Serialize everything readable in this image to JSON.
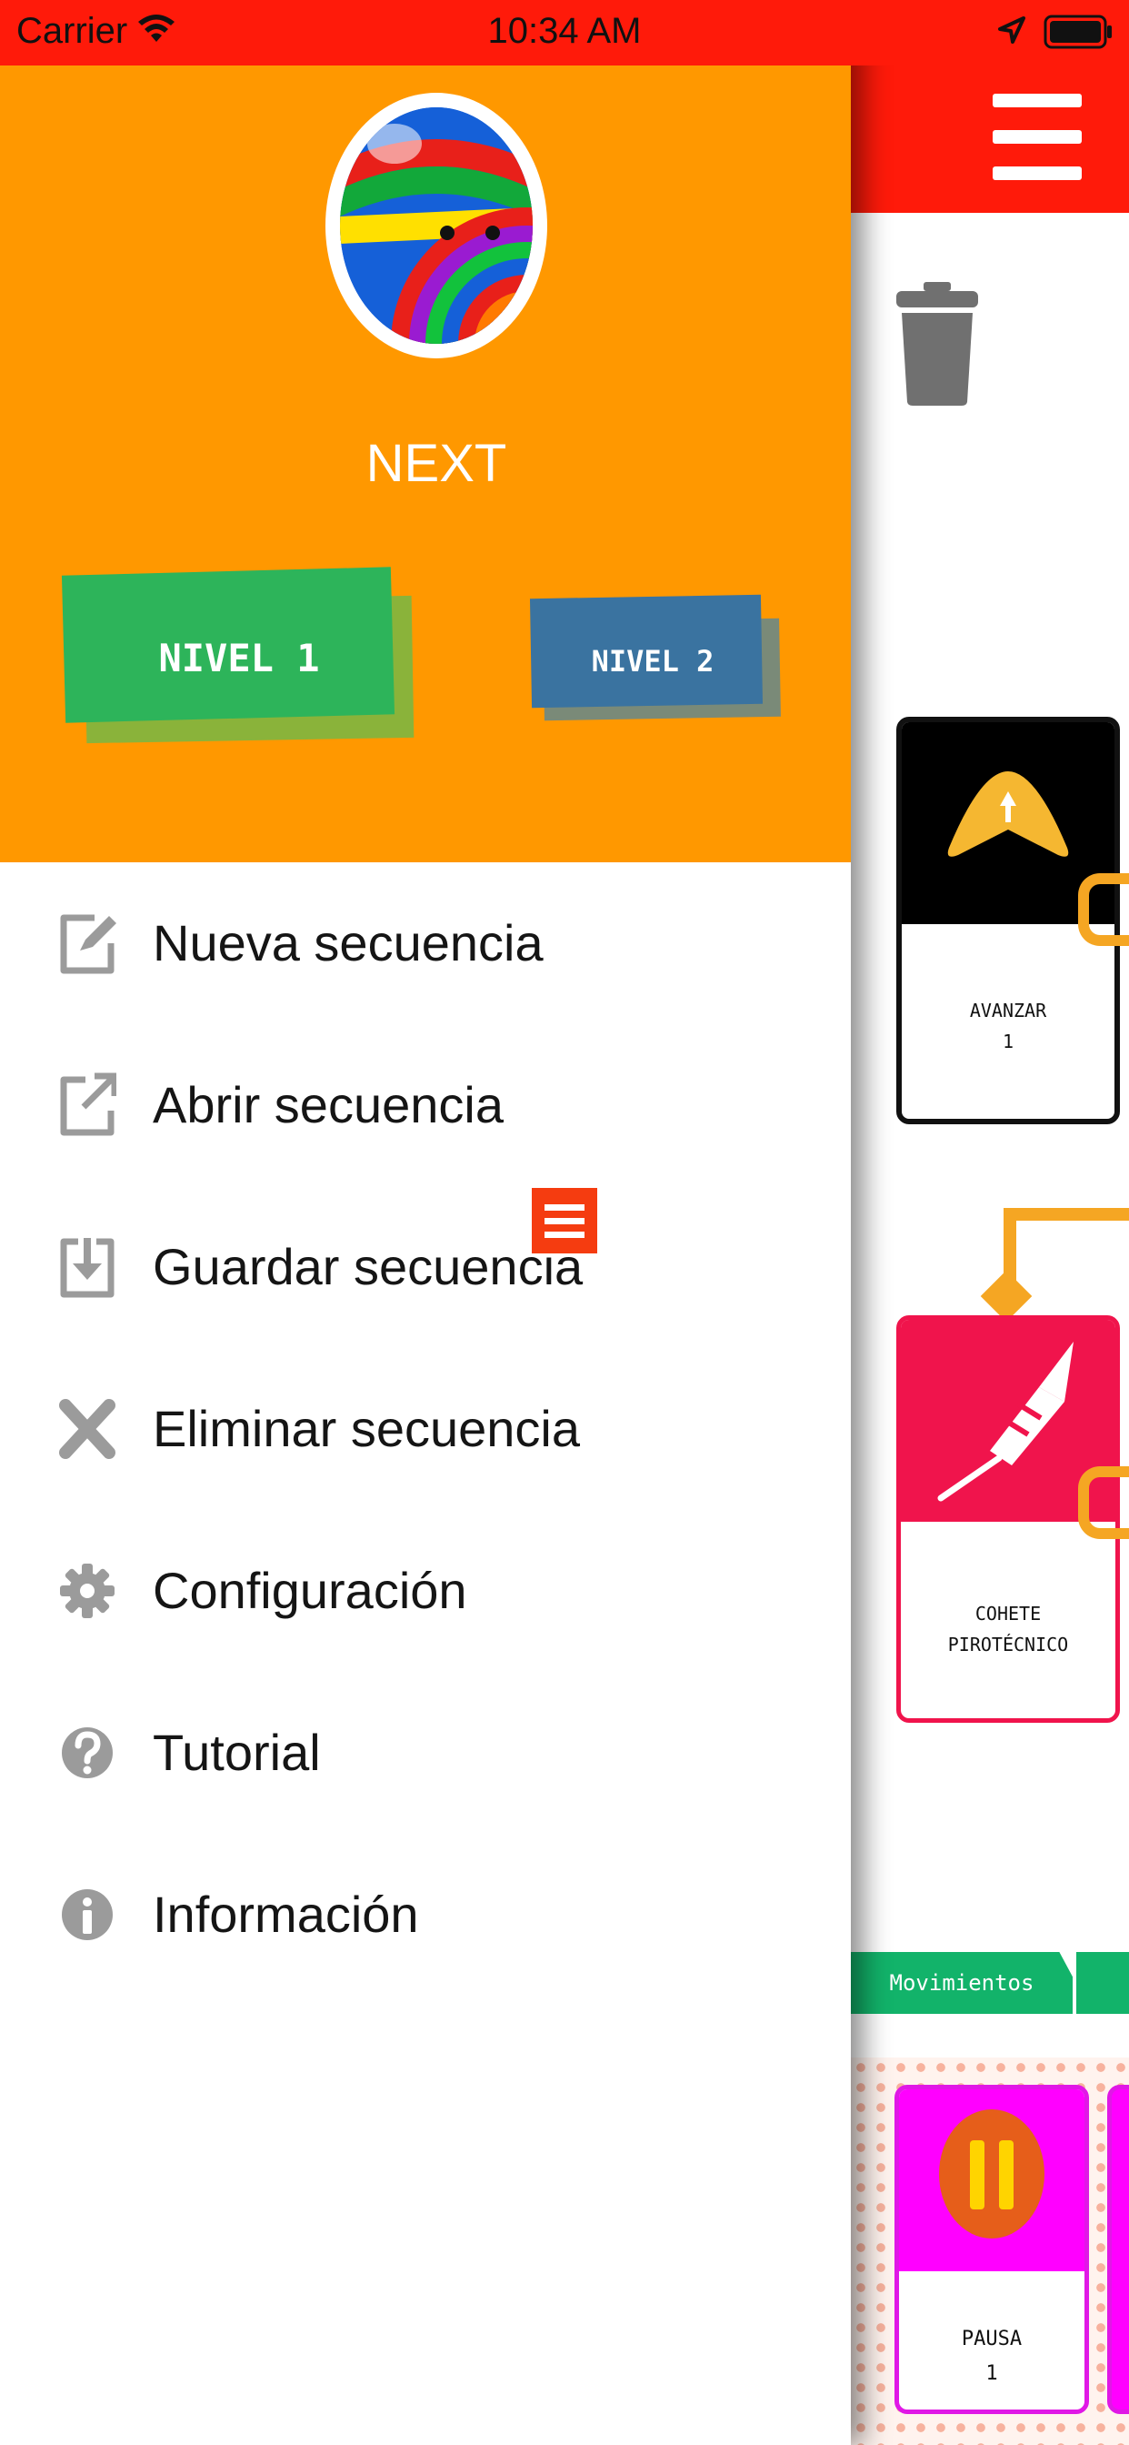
{
  "status_bar": {
    "carrier": "Carrier",
    "time": "10:34 AM",
    "icons": [
      "wifi-icon",
      "location-arrow-icon",
      "battery-icon"
    ]
  },
  "drawer": {
    "app_name": "NEXT",
    "levels": [
      {
        "label": "NIVEL 1",
        "color": "#2db45a",
        "selected": true
      },
      {
        "label": "NIVEL 2",
        "color": "#3a73a0",
        "selected": false
      }
    ],
    "menu": [
      {
        "label": "Nueva secuencia",
        "icon": "edit-icon"
      },
      {
        "label": "Abrir secuencia",
        "icon": "open-external-icon"
      },
      {
        "label": "Guardar secuencia",
        "icon": "save-icon"
      },
      {
        "label": "Eliminar secuencia",
        "icon": "close-icon"
      },
      {
        "label": "Configuración",
        "icon": "gear-icon"
      },
      {
        "label": "Tutorial",
        "icon": "help-icon"
      },
      {
        "label": "Información",
        "icon": "info-icon"
      }
    ]
  },
  "app": {
    "cards": [
      {
        "line1": "AVANZAR",
        "line2": "1",
        "icon": "arrow-up-icon"
      },
      {
        "line1": "COHETE",
        "line2": "PIROTÉCNICO",
        "icon": "rocket-icon"
      }
    ],
    "tabs": [
      {
        "label": "Movimientos"
      }
    ],
    "palette": [
      {
        "line1": "PAUSA",
        "line2": "1",
        "icon": "pause-icon"
      }
    ]
  },
  "colors": {
    "header_red": "#ff1a0a",
    "drawer_orange": "#ff9800",
    "tab_green": "#12b36a",
    "connector_orange": "#f5a623",
    "rocket_pink": "#f0144c",
    "pause_magenta": "#ff00ff"
  }
}
